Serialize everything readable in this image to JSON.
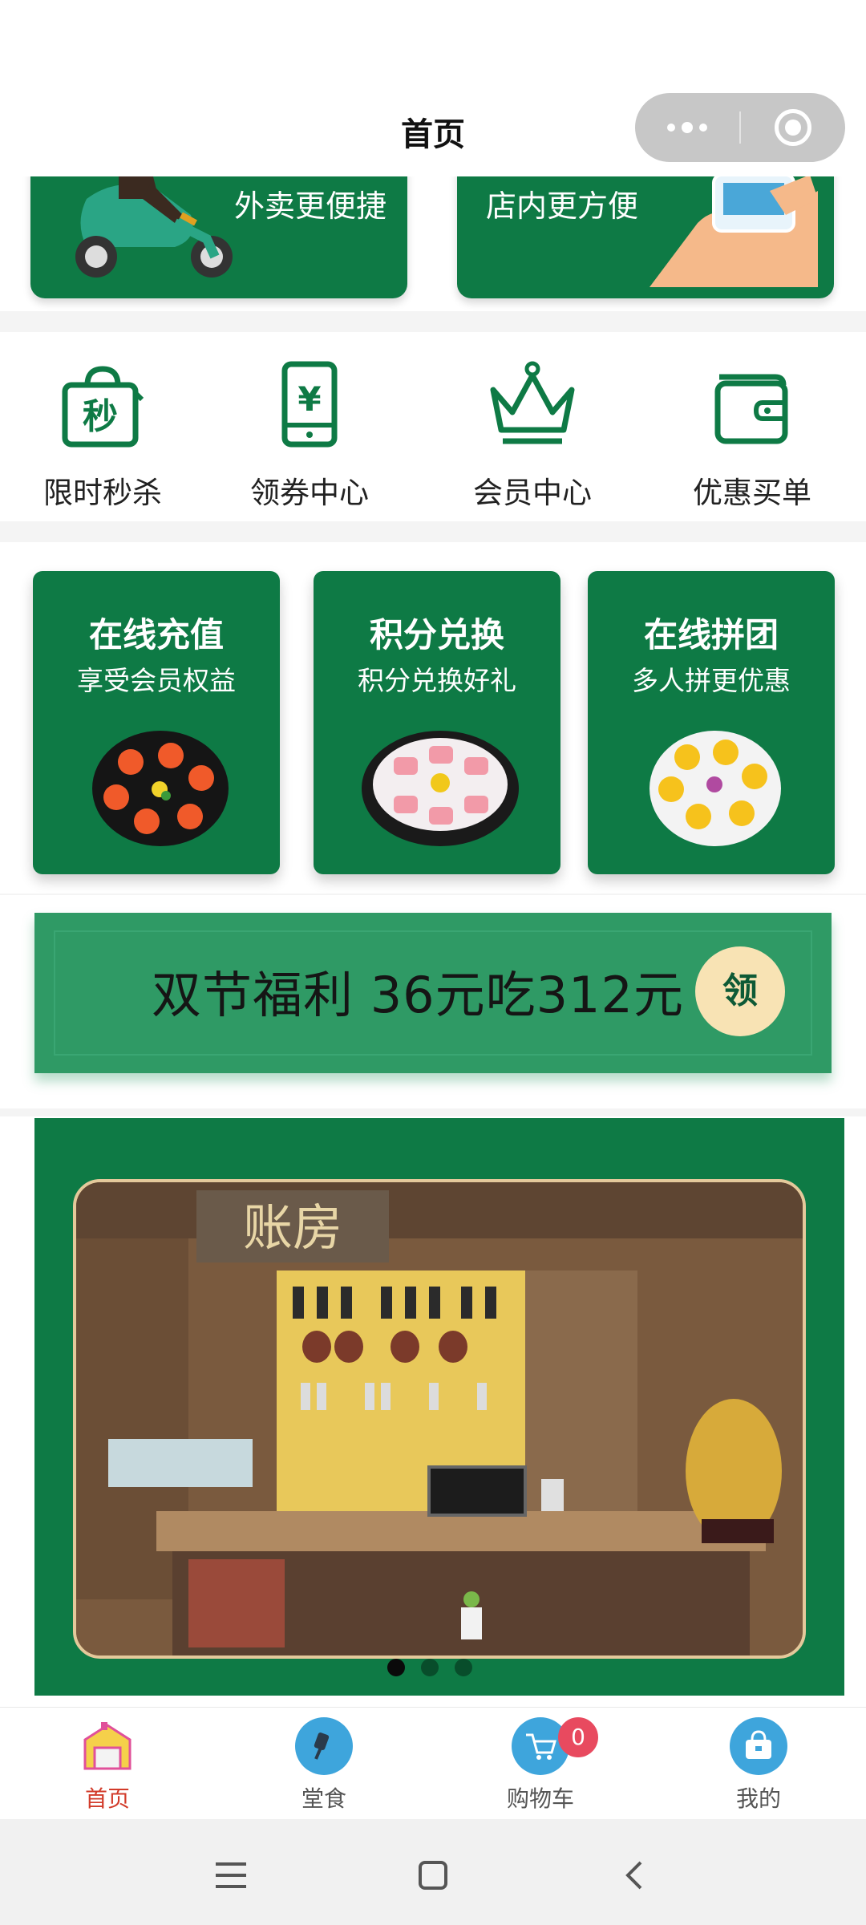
{
  "header": {
    "title": "首页"
  },
  "top_cards": {
    "delivery_label": "外卖更便捷",
    "dinein_label": "店内更方便"
  },
  "menu": [
    {
      "label": "限时秒杀",
      "icon": "flash-sale-bag-icon",
      "icon_text": "秒"
    },
    {
      "label": "领券中心",
      "icon": "coupon-phone-icon",
      "icon_text": "¥"
    },
    {
      "label": "会员中心",
      "icon": "crown-icon"
    },
    {
      "label": "优惠买单",
      "icon": "wallet-icon"
    }
  ],
  "features": [
    {
      "title": "在线充值",
      "subtitle": "享受会员权益",
      "image": "tomato-dish-image"
    },
    {
      "title": "积分兑换",
      "subtitle": "积分兑换好礼",
      "image": "meat-roll-dish-image"
    },
    {
      "title": "在线拼团",
      "subtitle": "多人拼更优惠",
      "image": "chick-dessert-image"
    }
  ],
  "promo": {
    "text": "双节福利 36元吃312元",
    "button": "领"
  },
  "store_banner": {
    "sign_text": "账房",
    "slides": 3,
    "active_slide": 1
  },
  "tabbar": [
    {
      "label": "首页",
      "icon": "home-icon",
      "active": true
    },
    {
      "label": "堂食",
      "icon": "dine-in-icon",
      "active": false
    },
    {
      "label": "购物车",
      "icon": "cart-icon",
      "active": false,
      "badge": "0"
    },
    {
      "label": "我的",
      "icon": "profile-bag-icon",
      "active": false
    }
  ],
  "colors": {
    "brand_green": "#0e7a45",
    "promo_green": "#2f9a65",
    "accent_red": "#d23b2a",
    "badge_red": "#e84a5f",
    "tab_icon_blue": "#3ea5dc"
  }
}
